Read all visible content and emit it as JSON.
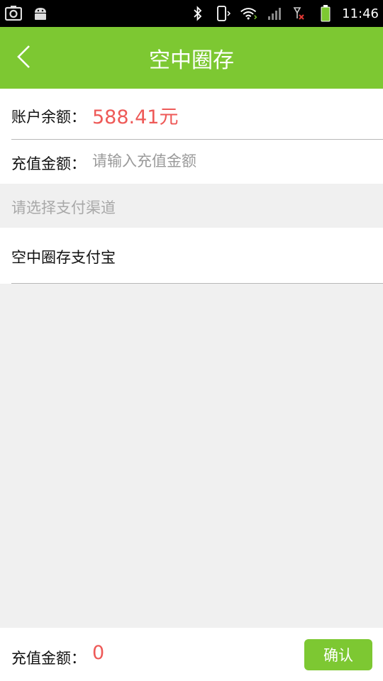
{
  "status_bar": {
    "time": "11:46",
    "icons_left": [
      "screenshot-icon",
      "android-icon"
    ],
    "icons_right": [
      "bluetooth-icon",
      "vibrate-icon",
      "wifi-icon",
      "signal-icon",
      "no-signal-icon",
      "battery-icon"
    ]
  },
  "header": {
    "title": "空中圈存",
    "background": "#7dc832"
  },
  "balance": {
    "label": "账户余额：",
    "value": "588.41元"
  },
  "amount": {
    "label": "充值金额：",
    "placeholder": "请输入充值金额",
    "value": ""
  },
  "payment": {
    "section_hint": "请选择支付渠道",
    "option": "空中圈存支付宝"
  },
  "footer": {
    "label": "充值金额：",
    "total": "0",
    "confirm_label": "确认"
  },
  "colors": {
    "accent": "#7dc832",
    "value_red": "#ee5a58",
    "placeholder": "#9a9a9a",
    "background": "#f0f0f0"
  }
}
